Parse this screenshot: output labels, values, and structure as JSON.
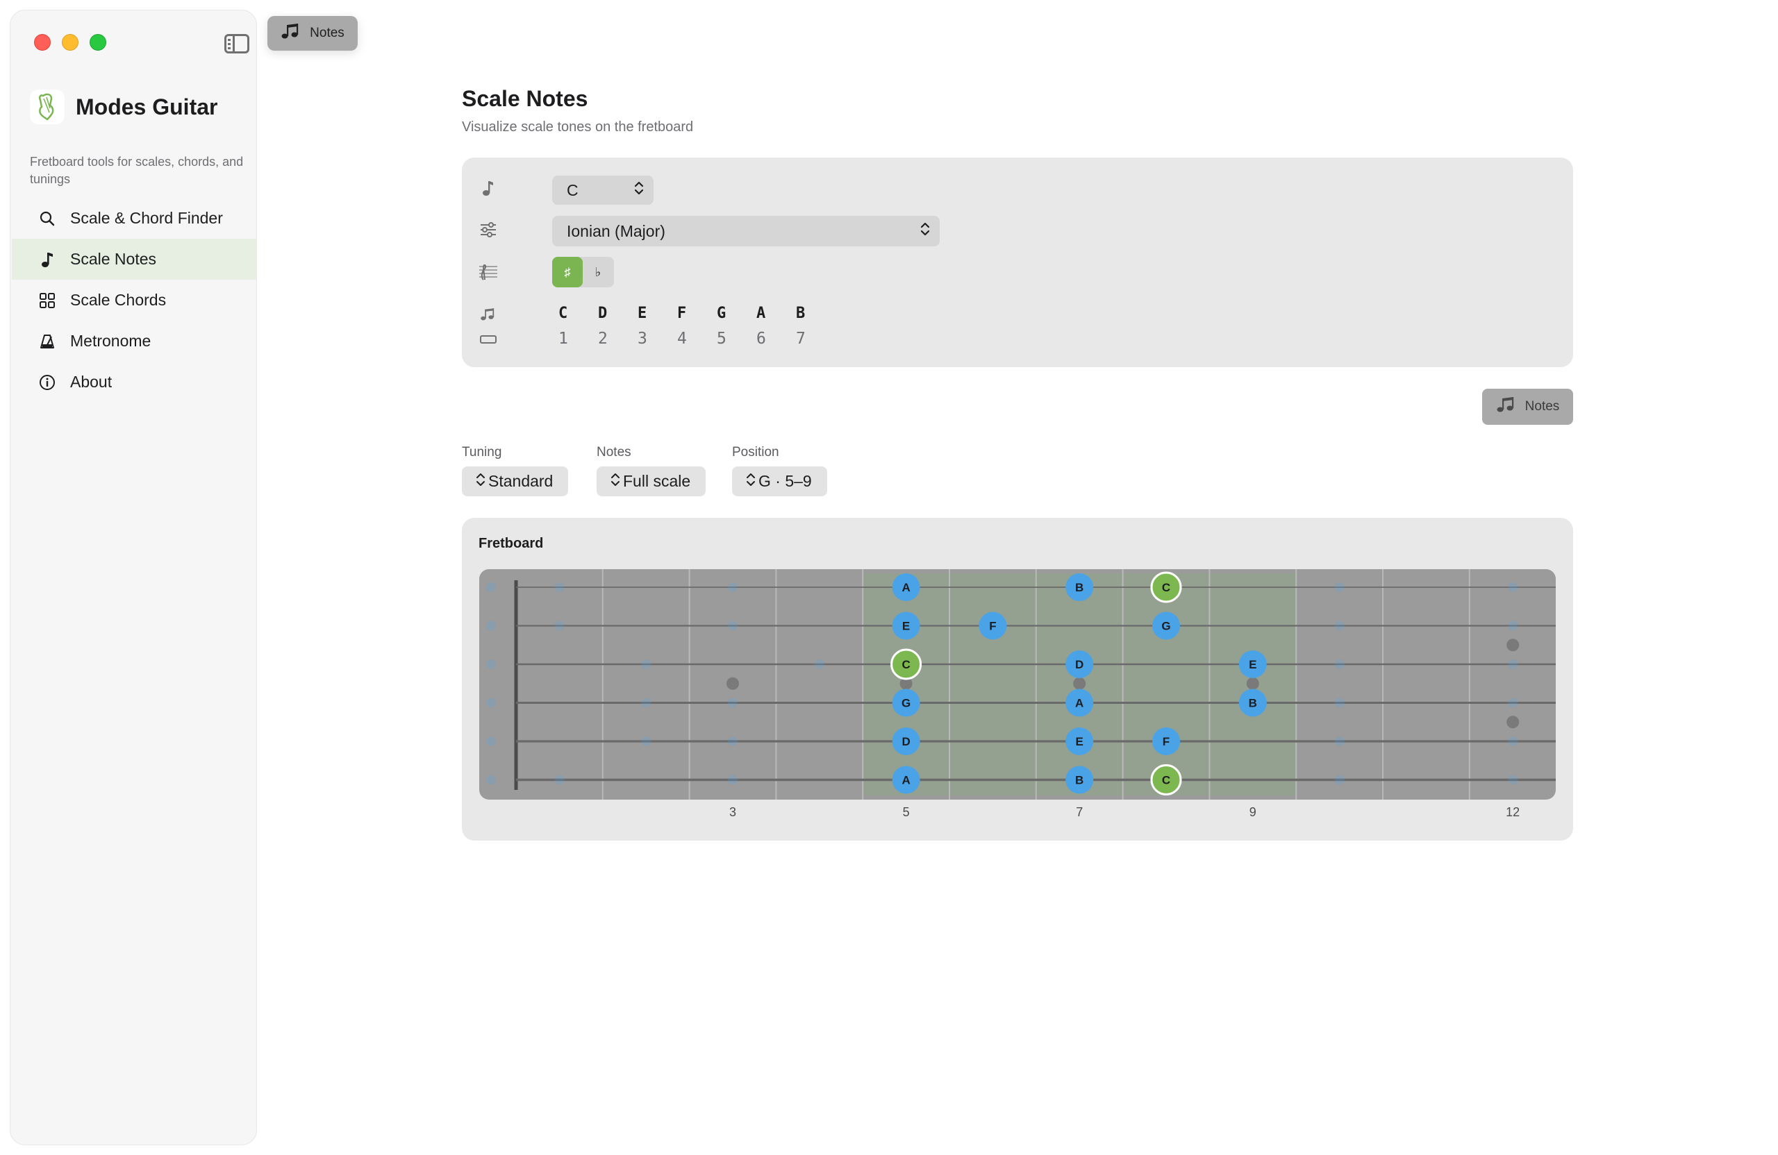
{
  "app": {
    "name": "Modes Guitar",
    "description": "Fretboard tools for scales, chords, and tunings"
  },
  "toolbar": {
    "notes_label": "Notes"
  },
  "sidebar": {
    "items": [
      {
        "label": "Scale & Chord Finder",
        "icon": "search-icon",
        "active": false
      },
      {
        "label": "Scale Notes",
        "icon": "music-note-icon",
        "active": true
      },
      {
        "label": "Scale Chords",
        "icon": "grid-icon",
        "active": false
      },
      {
        "label": "Metronome",
        "icon": "metronome-icon",
        "active": false
      },
      {
        "label": "About",
        "icon": "info-icon",
        "active": false
      }
    ]
  },
  "page": {
    "title": "Scale Notes",
    "subtitle": "Visualize scale tones on the fretboard"
  },
  "settings": {
    "root_value": "C",
    "mode_value": "Ionian (Major)",
    "accidental_sharp": "♯",
    "accidental_flat": "♭",
    "accidental_selected": "sharp",
    "scale_notes": [
      "C",
      "D",
      "E",
      "F",
      "G",
      "A",
      "B"
    ],
    "scale_degrees": [
      "1",
      "2",
      "3",
      "4",
      "5",
      "6",
      "7"
    ]
  },
  "notes_button": {
    "label": "Notes"
  },
  "filters": {
    "tuning": {
      "label": "Tuning",
      "value": "Standard"
    },
    "notes": {
      "label": "Notes",
      "value": "Full scale"
    },
    "position": {
      "label": "Position",
      "value": "G · 5–9"
    }
  },
  "fretboard": {
    "title": "Fretboard",
    "fret_numbers": [
      "3",
      "5",
      "7",
      "9",
      "12"
    ],
    "highlight_range": [
      5,
      9
    ],
    "notes": [
      {
        "string": 1,
        "fret": 5,
        "label": "A",
        "root": false
      },
      {
        "string": 1,
        "fret": 7,
        "label": "B",
        "root": false
      },
      {
        "string": 1,
        "fret": 8,
        "label": "C",
        "root": true
      },
      {
        "string": 2,
        "fret": 5,
        "label": "E",
        "root": false
      },
      {
        "string": 2,
        "fret": 6,
        "label": "F",
        "root": false
      },
      {
        "string": 2,
        "fret": 8,
        "label": "G",
        "root": false
      },
      {
        "string": 3,
        "fret": 5,
        "label": "C",
        "root": true
      },
      {
        "string": 3,
        "fret": 7,
        "label": "D",
        "root": false
      },
      {
        "string": 3,
        "fret": 9,
        "label": "E",
        "root": false
      },
      {
        "string": 4,
        "fret": 5,
        "label": "G",
        "root": false
      },
      {
        "string": 4,
        "fret": 7,
        "label": "A",
        "root": false
      },
      {
        "string": 4,
        "fret": 9,
        "label": "B",
        "root": false
      },
      {
        "string": 5,
        "fret": 5,
        "label": "D",
        "root": false
      },
      {
        "string": 5,
        "fret": 7,
        "label": "E",
        "root": false
      },
      {
        "string": 5,
        "fret": 8,
        "label": "F",
        "root": false
      },
      {
        "string": 6,
        "fret": 5,
        "label": "A",
        "root": false
      },
      {
        "string": 6,
        "fret": 7,
        "label": "B",
        "root": false
      },
      {
        "string": 6,
        "fret": 8,
        "label": "C",
        "root": true
      }
    ]
  },
  "colors": {
    "accent_green": "#7bb552",
    "note_blue": "#4aa3e6",
    "root_green": "#7cb84f",
    "fretboard_bg": "#9b9b9b"
  }
}
